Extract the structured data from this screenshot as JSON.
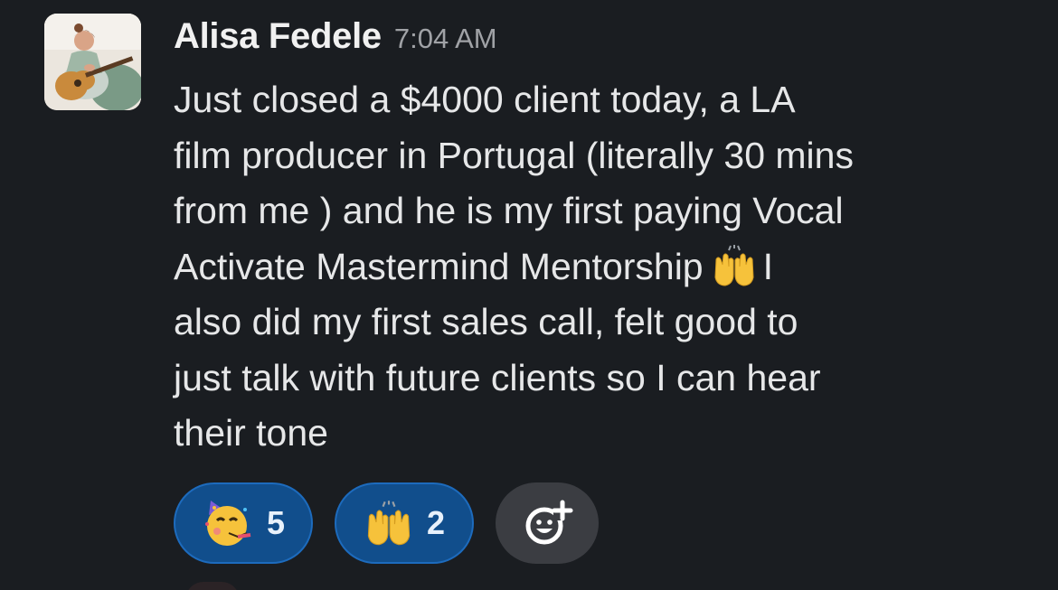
{
  "message": {
    "author": "Alisa Fedele",
    "timestamp": "7:04 AM",
    "avatar_icon": "user-avatar-guitar",
    "lines": [
      "Just closed a $4000 client today, a LA",
      "film producer in Portugal (literally 30 mins",
      "from me ) and he is my first paying Vocal",
      "Activate Mastermind Mentorship",
      "also did my first sales call, felt good to",
      "just talk with future clients so I can hear",
      "their tone"
    ],
    "line4_after_emoji": "I",
    "inline_emoji": "raising-hands-icon"
  },
  "reactions": [
    {
      "emoji": "partying-face-icon",
      "count": "5",
      "active": true
    },
    {
      "emoji": "raising-hands-icon",
      "count": "2",
      "active": true
    }
  ],
  "add_reaction": {
    "icon": "add-reaction-icon"
  },
  "colors": {
    "background": "#1a1d21",
    "reaction_active_bg": "#114e8c",
    "reaction_active_border": "#1d6bbd",
    "add_reaction_bg": "#3b3d42"
  }
}
